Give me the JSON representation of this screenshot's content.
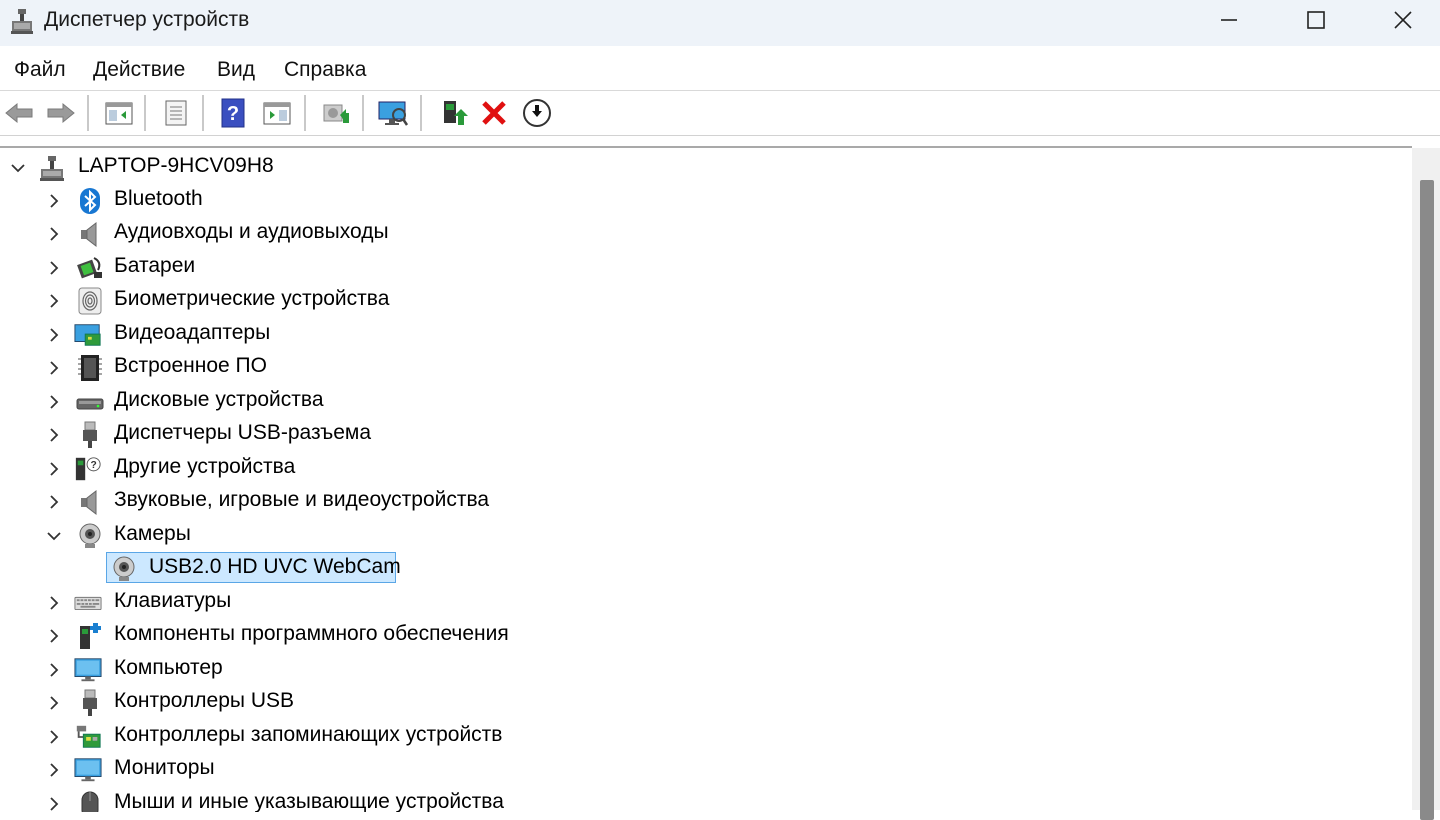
{
  "window": {
    "title": "Диспетчер устройств",
    "controls": [
      "minimize-icon",
      "maximize-icon",
      "close-icon"
    ]
  },
  "menu": [
    "Файл",
    "Действие",
    "Вид",
    "Справка"
  ],
  "toolbar": [
    "back-arrow-icon",
    "forward-arrow-icon",
    "show-hide-console-tree-icon",
    "properties-icon",
    "help-icon",
    "action-pane-icon",
    "update-driver-icon",
    "scan-hardware-icon",
    "enable-device-icon",
    "uninstall-device-icon",
    "disable-device-icon"
  ],
  "tree": {
    "root": "LAPTOP-9HCV09H8",
    "categories": [
      {
        "label": "Bluetooth",
        "icon": "bluetooth-icon"
      },
      {
        "label": "Аудиовходы и аудиовыходы",
        "icon": "speaker-icon"
      },
      {
        "label": "Батареи",
        "icon": "battery-icon"
      },
      {
        "label": "Биометрические устройства",
        "icon": "fingerprint-icon"
      },
      {
        "label": "Видеоадаптеры",
        "icon": "display-adapter-icon"
      },
      {
        "label": "Встроенное ПО",
        "icon": "firmware-chip-icon"
      },
      {
        "label": "Дисковые устройства",
        "icon": "disk-drive-icon"
      },
      {
        "label": "Диспетчеры USB-разъема",
        "icon": "usb-connector-icon"
      },
      {
        "label": "Другие устройства",
        "icon": "unknown-device-icon"
      },
      {
        "label": "Звуковые, игровые и видеоустройства",
        "icon": "speaker-icon"
      },
      {
        "label": "Камеры",
        "icon": "camera-icon",
        "expanded": true,
        "children": [
          "USB2.0 HD UVC WebCam"
        ]
      },
      {
        "label": "Клавиатуры",
        "icon": "keyboard-icon"
      },
      {
        "label": "Компоненты программного обеспечения",
        "icon": "software-component-icon"
      },
      {
        "label": "Компьютер",
        "icon": "computer-monitor-icon"
      },
      {
        "label": "Контроллеры USB",
        "icon": "usb-controller-icon"
      },
      {
        "label": "Контроллеры запоминающих устройств",
        "icon": "storage-controller-icon"
      },
      {
        "label": "Мониторы",
        "icon": "monitor-icon"
      },
      {
        "label": "Мыши и иные указывающие устройства",
        "icon": "mouse-icon"
      }
    ],
    "selected": "USB2.0 HD UVC WebCam"
  }
}
